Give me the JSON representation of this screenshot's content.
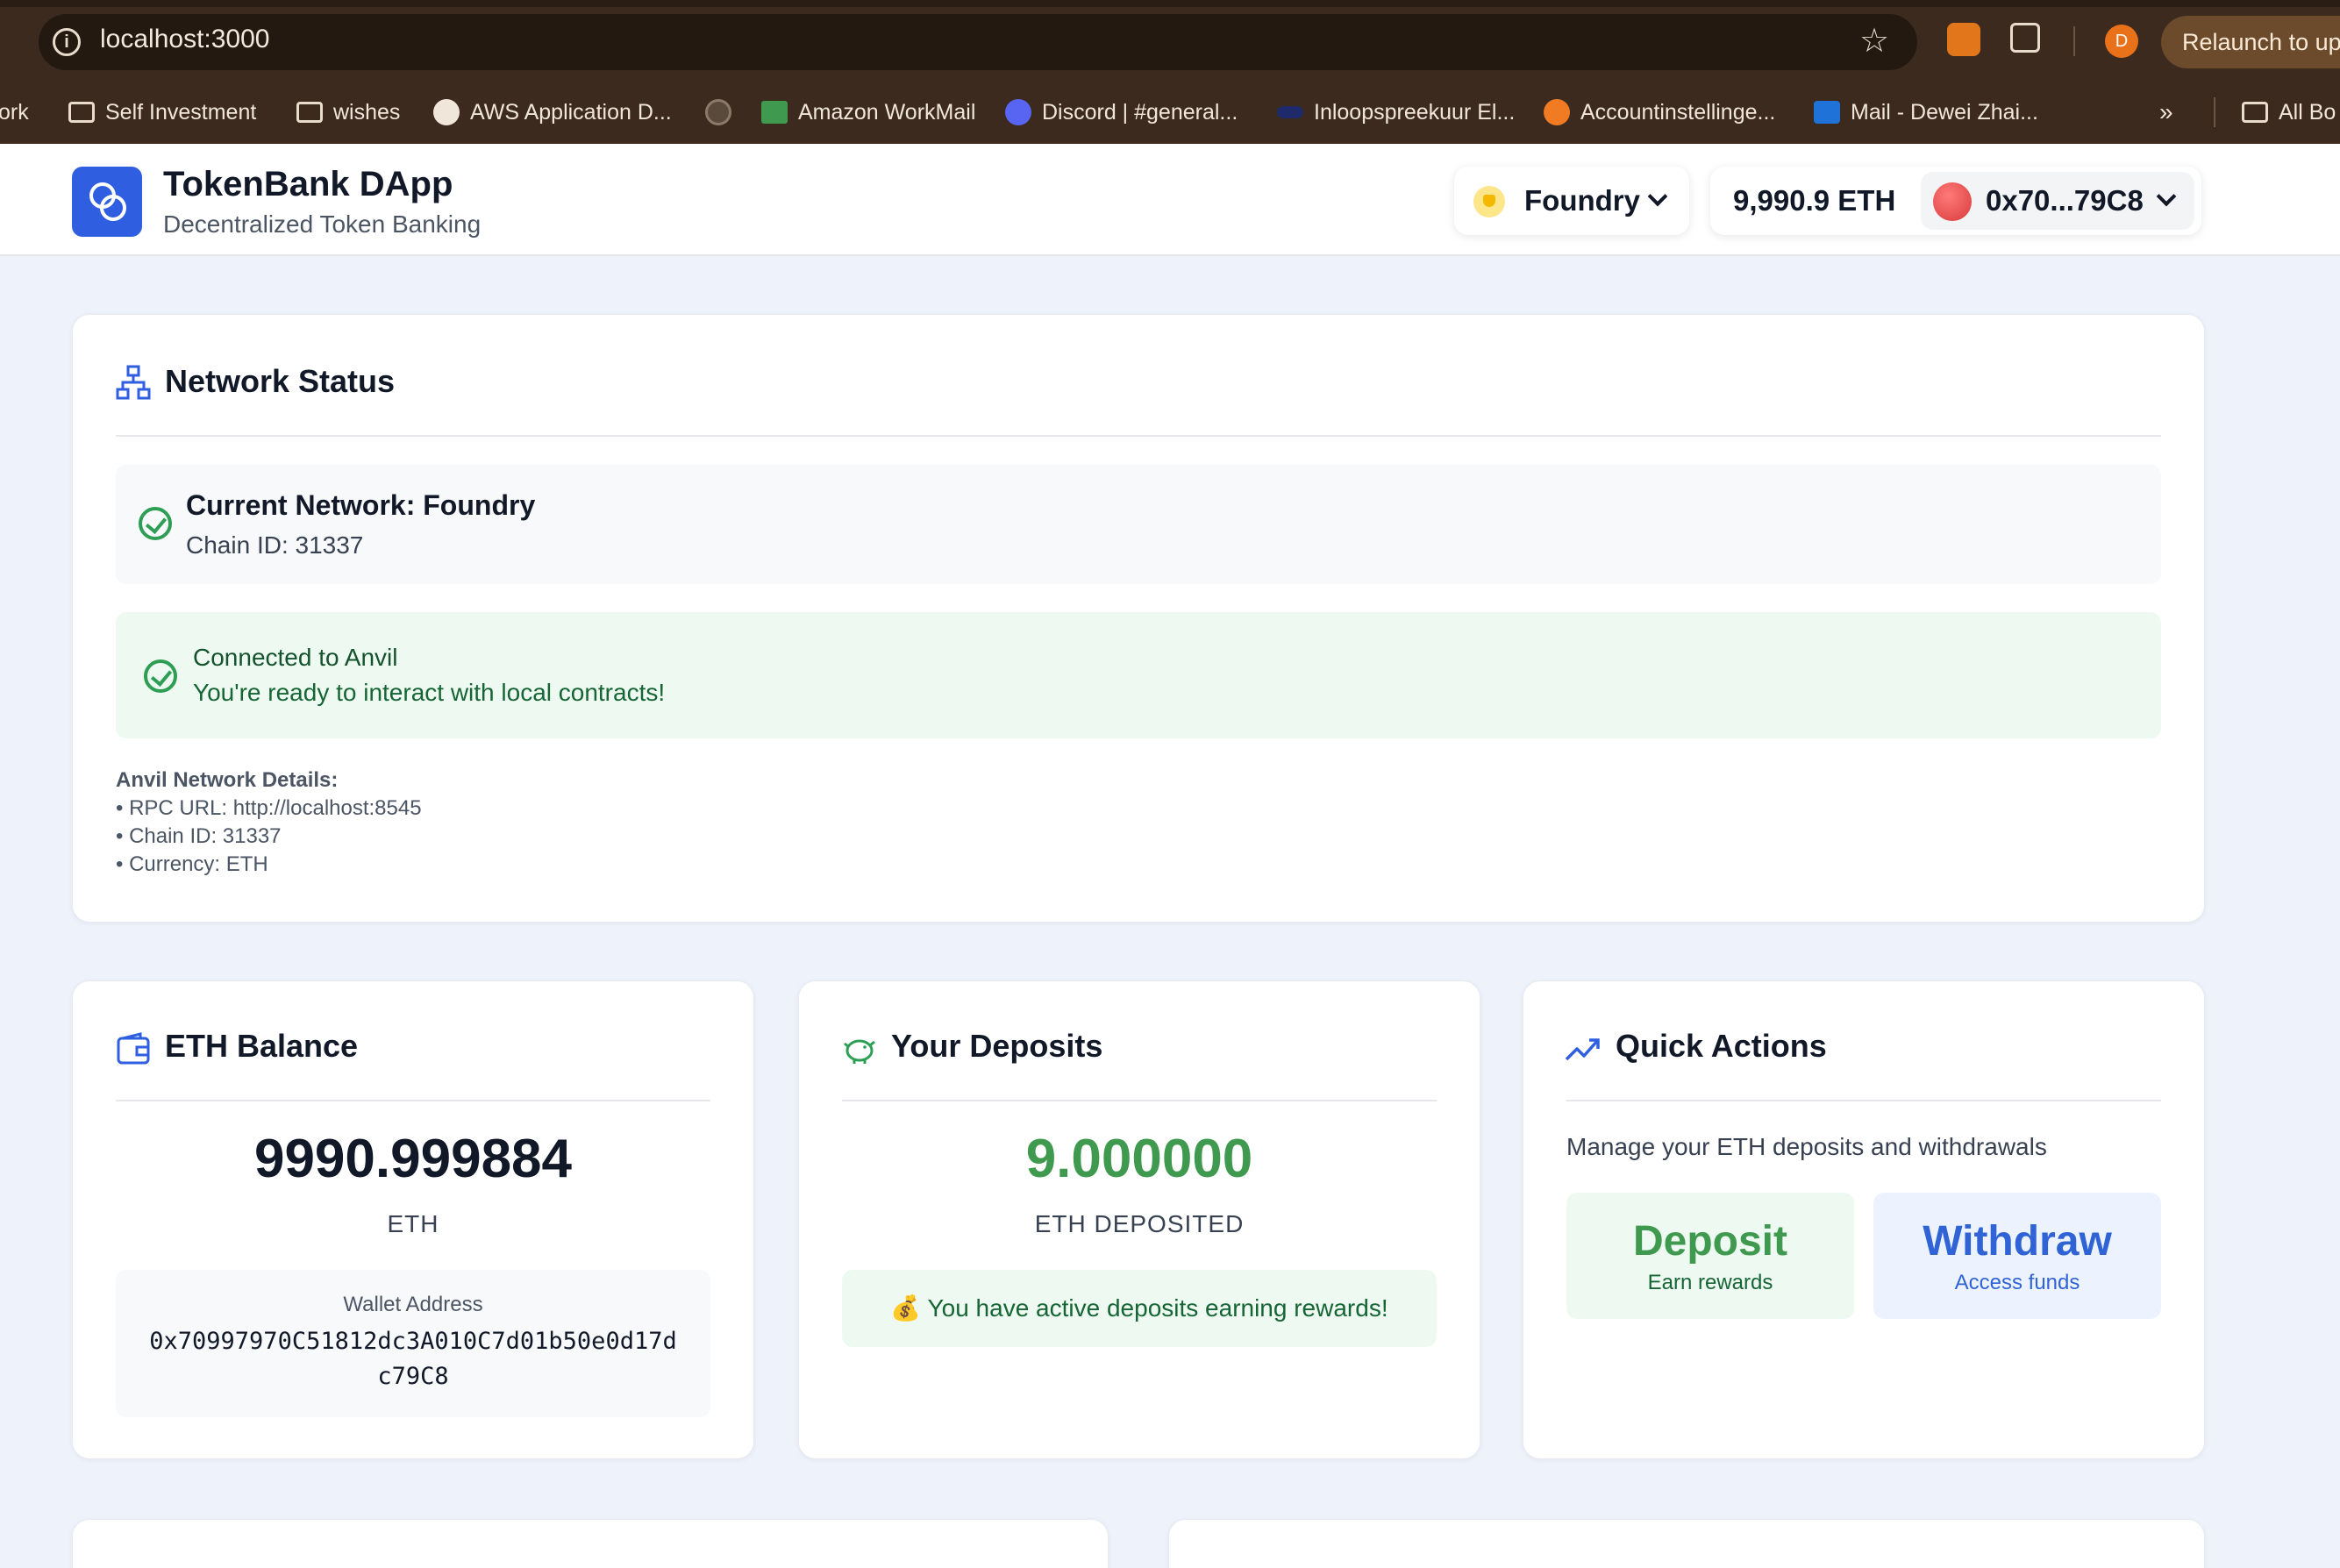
{
  "browser": {
    "url": "localhost:3000",
    "relaunch_label": "Relaunch to up",
    "profile_initial": "D",
    "bookmarks": [
      "ork",
      "Self Investment",
      "wishes",
      "AWS Application D...",
      "Amazon WorkMail",
      "Discord | #general...",
      "Inloopspreekuur El...",
      "Accountinstellinge...",
      "Mail - Dewei Zhai..."
    ],
    "all_bookmarks": "All Bo"
  },
  "header": {
    "title": "TokenBank DApp",
    "subtitle": "Decentralized Token Banking",
    "network": "Foundry",
    "balance": "9,990.9 ETH",
    "address": "0x70...79C8"
  },
  "network_status": {
    "title": "Network Status",
    "current_network": "Current Network: Foundry",
    "chain_id": "Chain ID: 31337",
    "connected_title": "Connected to Anvil",
    "connected_msg": "You're ready to interact with local contracts!",
    "details_title": "Anvil Network Details:",
    "details": [
      "• RPC URL: http://localhost:8545",
      "• Chain ID: 31337",
      "• Currency: ETH"
    ]
  },
  "eth_balance": {
    "title": "ETH Balance",
    "value": "9990.999884",
    "unit": "ETH",
    "wallet_label": "Wallet Address",
    "wallet_line1": "0x70997970C51812dc3A010C7d01b50e0d17d",
    "wallet_line2": "c79C8"
  },
  "deposits": {
    "title": "Your Deposits",
    "value": "9.000000",
    "unit": "ETH DEPOSITED",
    "message": "💰 You have active deposits earning rewards!"
  },
  "quick_actions": {
    "title": "Quick Actions",
    "description": "Manage your ETH deposits and withdrawals",
    "deposit_label": "Deposit",
    "deposit_sub": "Earn rewards",
    "withdraw_label": "Withdraw",
    "withdraw_sub": "Access funds"
  },
  "colors": {
    "accent_blue": "#2f5fe0",
    "success_green": "#2e9e55",
    "deposit_green": "#3f9a4f",
    "withdraw_blue": "#2f63d6"
  }
}
